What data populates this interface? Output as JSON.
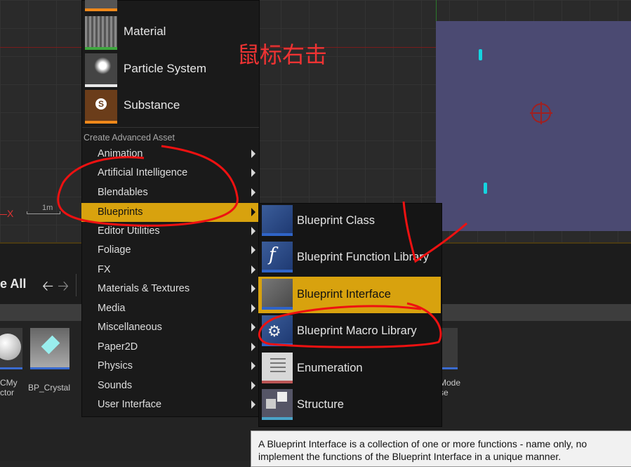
{
  "annotation_text": "鼠标右击",
  "viewport": {
    "axis_label": "X",
    "scale_label": "1m"
  },
  "toolbar": {
    "save_all_label": "e All",
    "back_glyph": "🡠",
    "forward_glyph": "🡢"
  },
  "assets": [
    {
      "label1": "CMy",
      "label2": "ctor"
    },
    {
      "label1": "BP_Crystal",
      "label2": ""
    },
    {
      "label1": "Mode",
      "label2": "se"
    }
  ],
  "menu": {
    "top_items": [
      {
        "label": "Material",
        "icon": "material-icon",
        "accent": "#3fa83f"
      },
      {
        "label": "Particle System",
        "icon": "particle-system-icon",
        "accent": "#e8e8e8"
      },
      {
        "label": "Substance",
        "icon": "substance-icon",
        "accent": "#f0891a"
      }
    ],
    "section_title": "Create Advanced Asset",
    "categories": [
      "Animation",
      "Artificial Intelligence",
      "Blendables",
      "Blueprints",
      "Editor Utilities",
      "Foliage",
      "FX",
      "Materials & Textures",
      "Media",
      "Miscellaneous",
      "Paper2D",
      "Physics",
      "Sounds",
      "User Interface"
    ],
    "active_category": "Blueprints"
  },
  "submenu": {
    "items": [
      {
        "label": "Blueprint Class",
        "icon": "blueprint-class-icon",
        "accent": "#2f64c8"
      },
      {
        "label": "Blueprint Function Library",
        "icon": "blueprint-function-library-icon",
        "accent": "#2f64c8"
      },
      {
        "label": "Blueprint Interface",
        "icon": "blueprint-interface-icon",
        "accent": "#2f64c8"
      },
      {
        "label": "Blueprint Macro Library",
        "icon": "blueprint-macro-library-icon",
        "accent": "#2f64c8"
      },
      {
        "label": "Enumeration",
        "icon": "enumeration-icon",
        "accent": "#b55"
      },
      {
        "label": "Structure",
        "icon": "structure-icon",
        "accent": "#4aa3c8"
      }
    ],
    "active_item": "Blueprint Interface"
  },
  "tooltip": {
    "line1": "A Blueprint Interface is a collection of one or more functions - name only, no",
    "line2": "implement the functions of the Blueprint Interface in a unique manner."
  },
  "colors": {
    "highlight": "#d8a20e",
    "annotation": "#e33",
    "menu_bg": "#1a1a1a"
  }
}
